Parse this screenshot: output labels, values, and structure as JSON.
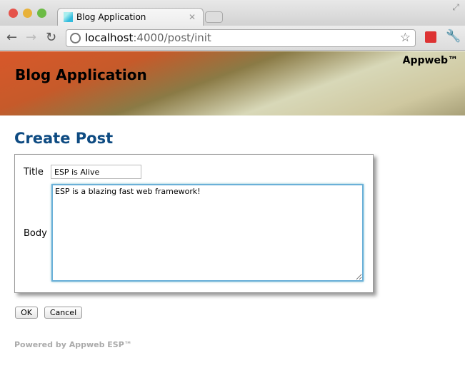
{
  "browser": {
    "tab_title": "Blog Application",
    "url_host": "localhost",
    "url_path": ":4000/post/init"
  },
  "header": {
    "title": "Blog Application",
    "brand": "Appweb™"
  },
  "page": {
    "title": "Create Post"
  },
  "form": {
    "title_label": "Title",
    "title_value": "ESP is Alive",
    "body_label": "Body",
    "body_value": "ESP is a blazing fast web framework!\n"
  },
  "buttons": {
    "ok": "OK",
    "cancel": "Cancel"
  },
  "footer": {
    "text": "Powered by Appweb ESP™"
  }
}
